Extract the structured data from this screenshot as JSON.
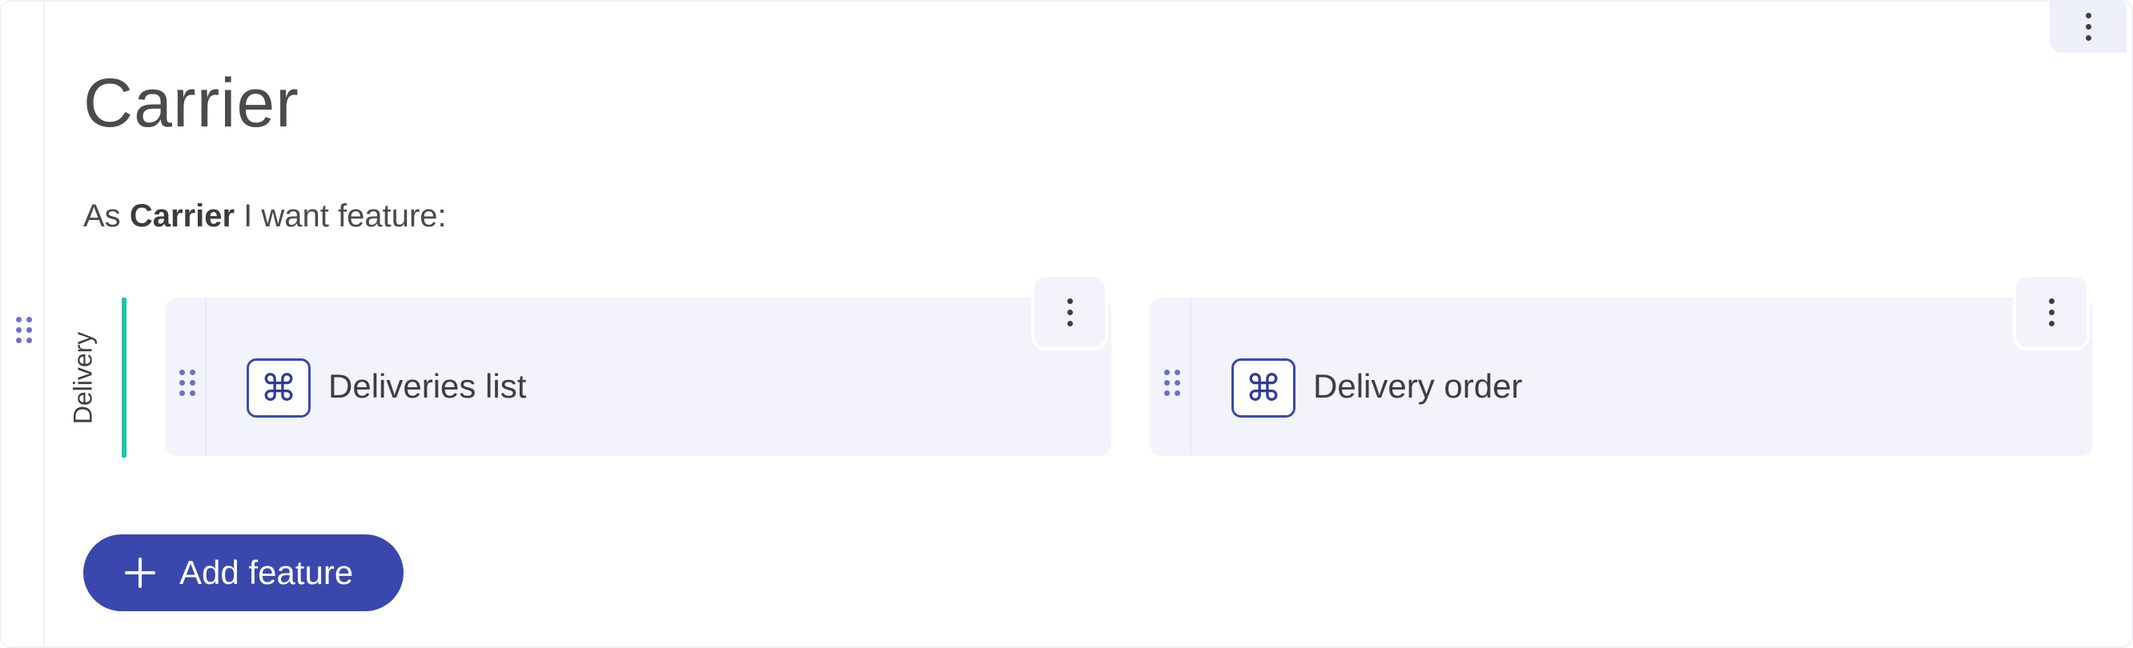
{
  "persona": {
    "title": "Carrier",
    "subtitle_prefix": "As",
    "subtitle_role": "Carrier",
    "subtitle_suffix": "I want feature:"
  },
  "group": {
    "label": "Delivery",
    "accent_color": "#1cc7a5"
  },
  "features": [
    {
      "title": "Deliveries list",
      "icon": "command-icon"
    },
    {
      "title": "Delivery order",
      "icon": "command-icon"
    }
  ],
  "actions": {
    "add_feature_label": "Add feature",
    "add_feature_icon": "plus-icon"
  },
  "colors": {
    "primary": "#3a48ad",
    "card_background": "#f2f3fb",
    "drag_handle": "#6b6fcf"
  }
}
